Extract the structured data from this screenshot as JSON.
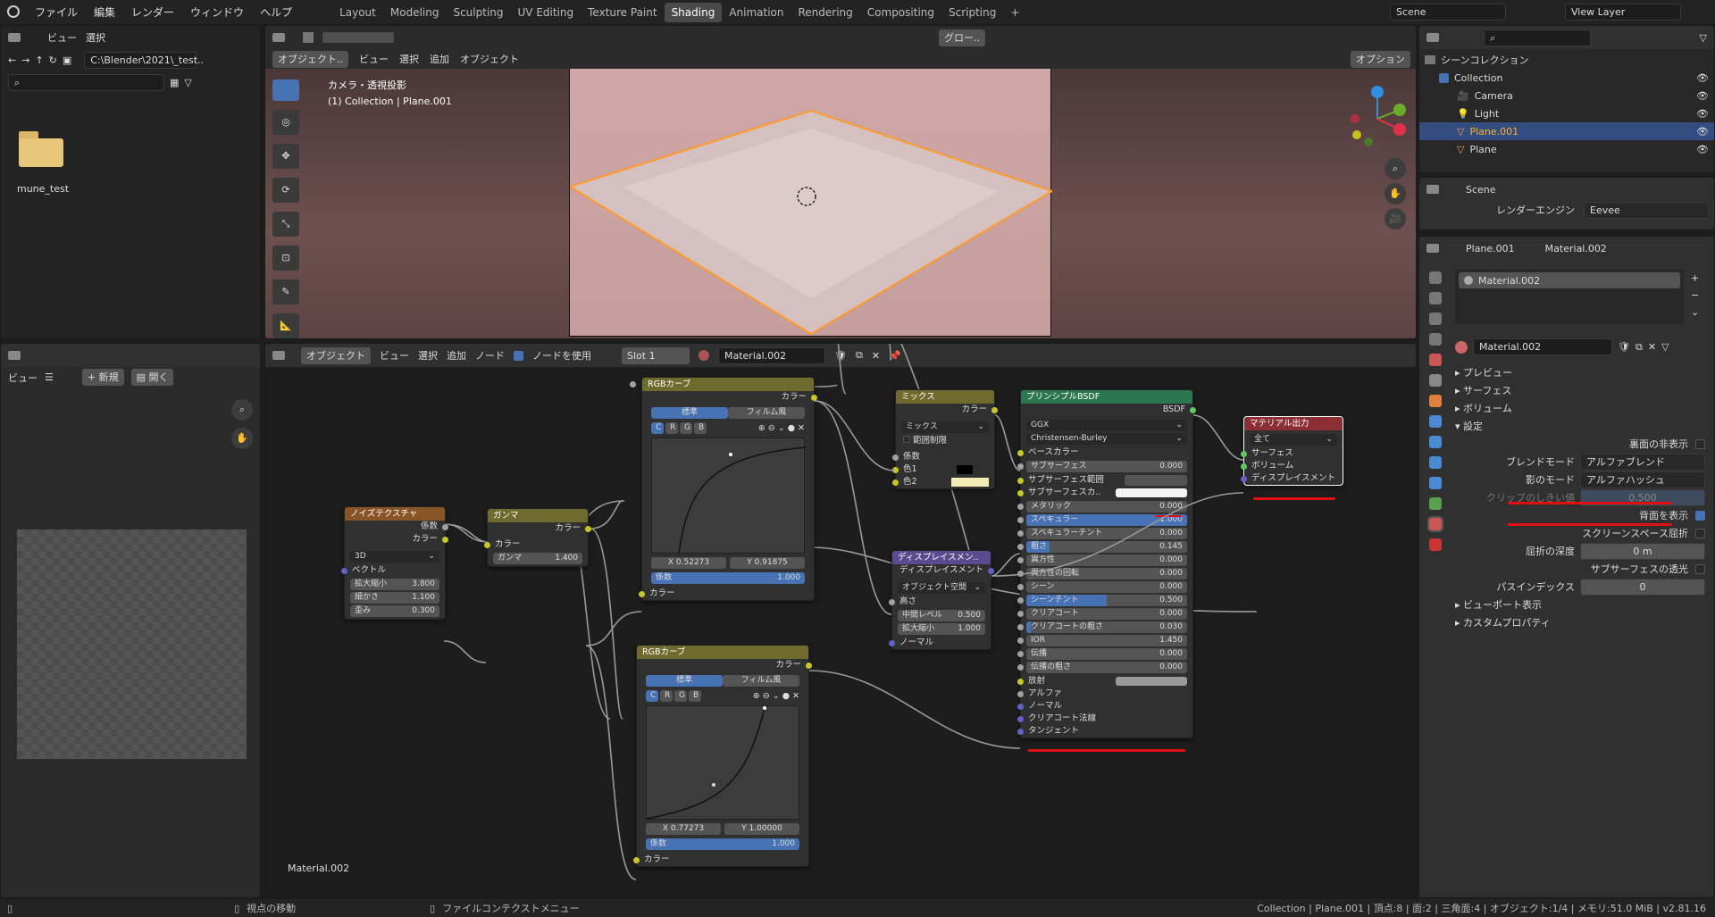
{
  "topbar": {
    "menus": [
      "ファイル",
      "編集",
      "レンダー",
      "ウィンドウ",
      "ヘルプ"
    ],
    "workspaces": [
      "Layout",
      "Modeling",
      "Sculpting",
      "UV Editing",
      "Texture Paint",
      "Shading",
      "Animation",
      "Rendering",
      "Compositing",
      "Scripting"
    ],
    "active_workspace": "Shading",
    "add_tab": "+",
    "scene": "Scene",
    "view_layer": "View Layer"
  },
  "file_browser": {
    "menu_view": "ビュー",
    "menu_select": "選択",
    "path": "C:\\Blender\\2021\\_test..",
    "search_placeholder": "",
    "folder_name": "mune_test"
  },
  "image_editor": {
    "menu_view": "ビュー",
    "new_button": "新規",
    "open_button": "開く"
  },
  "viewport": {
    "mode": "オブジェクト..",
    "menus": [
      "ビュー",
      "選択",
      "追加",
      "オブジェクト"
    ],
    "transform": "グロー..",
    "options": "オプション",
    "info_line1": "カメラ・透視投影",
    "info_line2": "(1) Collection | Plane.001"
  },
  "node_editor": {
    "mode": "オブジェクト",
    "menus": [
      "ビュー",
      "選択",
      "追加",
      "ノード"
    ],
    "use_nodes_label": "ノードを使用",
    "slot": "Slot 1",
    "material": "Material.002",
    "footer_label": "Material.002"
  },
  "nodes": {
    "noise": {
      "title": "ノイズテクスチャ",
      "out1": "係数",
      "out2": "カラー",
      "dim": "3D",
      "vector": "ベクトル",
      "scale_label": "拡大縮小",
      "scale": "3.800",
      "detail_label": "細かさ",
      "detail": "1.100",
      "distortion_label": "歪み",
      "distortion": "0.300"
    },
    "gamma": {
      "title": "ガンマ",
      "out": "カラー",
      "in": "カラー",
      "gamma_label": "ガンマ",
      "gamma": "1.400"
    },
    "rgb1": {
      "title": "RGBカーブ",
      "out": "カラー",
      "tab1": "標準",
      "tab2": "フィルム風",
      "channels": [
        "C",
        "R",
        "G",
        "B"
      ],
      "x": "X 0.52273",
      "y": "Y 0.91875",
      "fac_label": "係数",
      "fac": "1.000",
      "in": "カラー"
    },
    "rgb2": {
      "title": "RGBカーブ",
      "out": "カラー",
      "tab1": "標準",
      "tab2": "フィルム風",
      "channels": [
        "C",
        "R",
        "G",
        "B"
      ],
      "x": "X 0.77273",
      "y": "Y 1.00000",
      "fac_label": "係数",
      "fac": "1.000",
      "in": "カラー"
    },
    "mix": {
      "title": "ミックス",
      "out": "カラー",
      "blend": "ミックス",
      "clamp": "範囲制限",
      "fac": "係数",
      "c1": "色1",
      "c2": "色2"
    },
    "disp": {
      "title": "ディスプレイスメン..",
      "out": "ディスプレイスメント",
      "space": "オブジェクト空間",
      "height": "高さ",
      "mid_label": "中間レベル",
      "mid": "0.500",
      "scale_label": "拡大縮小",
      "scale": "1.000",
      "normal": "ノーマル"
    },
    "bsdf": {
      "title": "プリンシプルBSDF",
      "out": "BSDF",
      "dist": "GGX",
      "sss_method": "Christensen-Burley",
      "rows": [
        {
          "label": "ベースカラー",
          "value": ""
        },
        {
          "label": "サブサーフェス",
          "value": "0.000"
        },
        {
          "label": "サブサーフェス範囲",
          "value": ""
        },
        {
          "label": "サブサーフェスカ..",
          "value": ""
        },
        {
          "label": "メタリック",
          "value": "0.000"
        },
        {
          "label": "スペキュラー",
          "value": "1.000"
        },
        {
          "label": "スペキュラーチント",
          "value": "0.000"
        },
        {
          "label": "粗さ",
          "value": "0.145"
        },
        {
          "label": "異方性",
          "value": "0.000"
        },
        {
          "label": "異方性の回転",
          "value": "0.000"
        },
        {
          "label": "シーン",
          "value": "0.000"
        },
        {
          "label": "シーンチント",
          "value": "0.500"
        },
        {
          "label": "クリアコート",
          "value": "0.000"
        },
        {
          "label": "クリアコートの粗さ",
          "value": "0.030"
        },
        {
          "label": "IOR",
          "value": "1.450"
        },
        {
          "label": "伝播",
          "value": "0.000"
        },
        {
          "label": "伝播の粗さ",
          "value": "0.000"
        },
        {
          "label": "放射",
          "value": ""
        },
        {
          "label": "アルファ",
          "value": ""
        },
        {
          "label": "ノーマル",
          "value": ""
        },
        {
          "label": "クリアコート法線",
          "value": ""
        },
        {
          "label": "タンジェント",
          "value": ""
        }
      ]
    },
    "output": {
      "title": "マテリアル出力",
      "target": "全て",
      "surface": "サーフェス",
      "volume": "ボリューム",
      "disp": "ディスプレイスメント"
    }
  },
  "outliner": {
    "root": "シーンコレクション",
    "items": [
      {
        "name": "Collection",
        "level": 1
      },
      {
        "name": "Camera",
        "level": 2
      },
      {
        "name": "Light",
        "level": 2
      },
      {
        "name": "Plane.001",
        "level": 2
      },
      {
        "name": "Plane",
        "level": 2
      }
    ]
  },
  "scene_props": {
    "scene": "Scene",
    "engine_label": "レンダーエンジン",
    "engine": "Eevee"
  },
  "material_props": {
    "object": "Plane.001",
    "material": "Material.002",
    "slot": "Material.002",
    "sections": [
      "プレビュー",
      "サーフェス",
      "ボリューム",
      "設定"
    ],
    "backface": "裏面の非表示",
    "blend_label": "ブレンドモード",
    "blend": "アルファブレンド",
    "shadow_label": "影のモード",
    "shadow": "アルファハッシュ",
    "clip_label": "クリップのしきい値",
    "clip": "0.500",
    "show_back": "背面を表示",
    "ssr": "スクリーンスペース屈折",
    "depth_label": "屈折の深度",
    "depth": "0 m",
    "sss_trans": "サブサーフェスの透光",
    "pass_label": "パスインデックス",
    "pass": "0",
    "more_sections": [
      "ビューポート表示",
      "カスタムプロパティ"
    ]
  },
  "statusbar": {
    "left": "視点の移動",
    "mid": "ファイルコンテクストメニュー",
    "right": "Collection | Plane.001 | 頂点:8 | 面:2 | 三角面:4 | オブジェクト:1/4 | メモリ:51.0 MiB | v2.81.16"
  }
}
